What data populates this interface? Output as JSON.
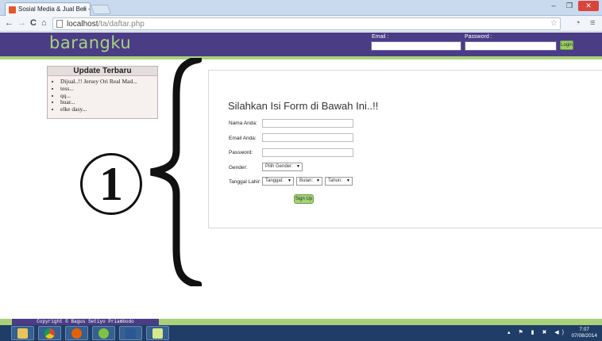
{
  "browser": {
    "tab_title": "Sosial Media & Jual Beli -",
    "tab_close": "×",
    "url_host": "localhost",
    "url_path": "/ta/daftar.php",
    "nav_back": "←",
    "nav_forward": "→",
    "nav_reload": "C",
    "nav_home": "⌂",
    "star": "☆",
    "menu": "≡"
  },
  "header": {
    "logo": "barangku",
    "email_label": "Email :",
    "password_label": "Password :",
    "login_button": "Login"
  },
  "sidebar": {
    "title": "Update Terbaru",
    "items": [
      "Dijual..!! Jersey Ori Real Mad...",
      "tess...",
      "qq...",
      "huar...",
      "elke dasy..."
    ]
  },
  "annotation": {
    "label": "①"
  },
  "form": {
    "title": "Silahkan Isi Form di Bawah Ini..!!",
    "name_label": "Nama Anda:",
    "email_label": "Email Anda:",
    "password_label": "Password:",
    "gender_label": "Gender:",
    "gender_select": "Pilih Gender:",
    "birth_label": "Tanggal Lahir:",
    "day_select": "Tanggal:",
    "month_select": "Bulan:",
    "year_select": "Tahun:",
    "signup_button": "Sign Up"
  },
  "footer": {
    "copyright": "Copyright © Bagus Setiyo Priambodo"
  },
  "taskbar": {
    "time": "7:07",
    "date": "07/08/2014"
  }
}
